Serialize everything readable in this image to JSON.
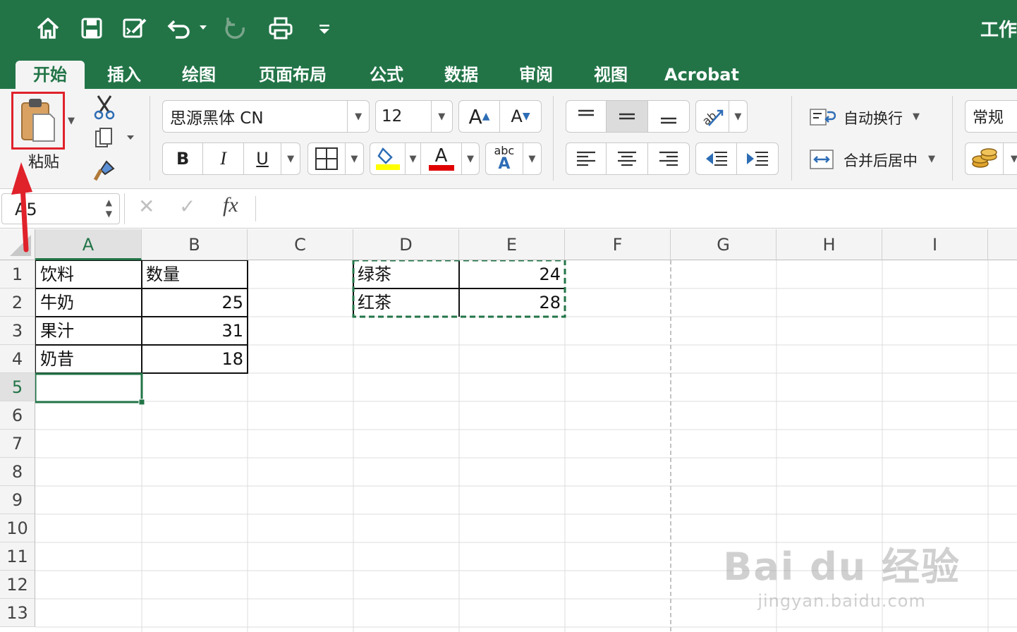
{
  "window": {
    "title": "工作"
  },
  "tabs": [
    "开始",
    "插入",
    "绘图",
    "页面布局",
    "公式",
    "数据",
    "审阅",
    "视图",
    "Acrobat"
  ],
  "ribbon": {
    "paste_label": "粘贴",
    "font_name": "思源黑体 CN",
    "font_size": "12",
    "wrap_text_label": "自动换行",
    "merge_center_label": "合并后居中",
    "number_format": "常规",
    "bold": "B",
    "italic": "I",
    "underline": "U",
    "font_color_letter": "A",
    "spell_abc": "abc",
    "spell_a": "A",
    "grow_font": "A",
    "shrink_font": "A"
  },
  "formula_bar": {
    "name_box": "A5",
    "fx": "fx",
    "cancel": "✕",
    "confirm": "✓",
    "content": ""
  },
  "columns": [
    "A",
    "B",
    "C",
    "D",
    "E",
    "F",
    "G",
    "H",
    "I"
  ],
  "rows": [
    "1",
    "2",
    "3",
    "4",
    "5",
    "6",
    "7",
    "8",
    "9",
    "10",
    "11",
    "12",
    "13"
  ],
  "cells": {
    "A1": "饮料",
    "B1": "数量",
    "A2": "牛奶",
    "B2": "25",
    "A3": "果汁",
    "B3": "31",
    "A4": "奶昔",
    "B4": "18",
    "D1": "绿茶",
    "E1": "24",
    "D2": "红茶",
    "E2": "28"
  },
  "selected_cell": "A5",
  "colors": {
    "accent": "#227447",
    "highlight": "#ffff00",
    "font_color": "#e00000",
    "annotation": "#e0222b"
  },
  "watermark": {
    "line1": "Bai du 经验",
    "line2": "jingyan.baidu.com"
  }
}
